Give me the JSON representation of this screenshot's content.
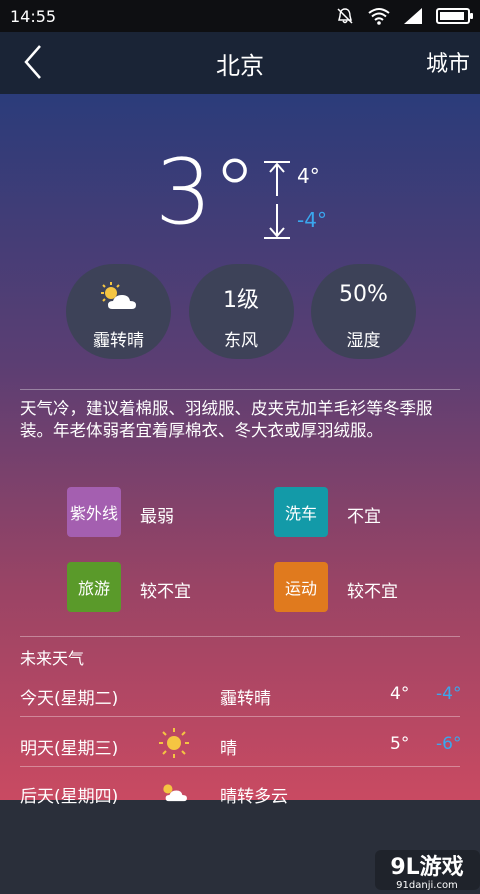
{
  "status_bar": {
    "time": "14:55"
  },
  "header": {
    "title": "北京",
    "city_button": "城市"
  },
  "current": {
    "temperature": "3°",
    "high": "4°",
    "low": "-4°"
  },
  "circles": [
    {
      "icon": "partly-cloudy-icon",
      "label": "霾转晴"
    },
    {
      "value": "1级",
      "label": "东风"
    },
    {
      "value": "50%",
      "label": "湿度"
    }
  ],
  "advice": "天气冷，建议着棉服、羽绒服、皮夹克加羊毛衫等冬季服装。年老体弱者宜着厚棉衣、冬大衣或厚羽绒服。",
  "indices": [
    {
      "name": "紫外线",
      "value": "最弱",
      "color": "#a45fb0"
    },
    {
      "name": "洗车",
      "value": "不宜",
      "color": "#139aa8"
    },
    {
      "name": "旅游",
      "value": "较不宜",
      "color": "#5a9a2a"
    },
    {
      "name": "运动",
      "value": "较不宜",
      "color": "#e07a1e"
    }
  ],
  "forecast": {
    "title": "未来天气",
    "days": [
      {
        "day": "今天(星期二)",
        "desc": "霾转晴",
        "high": "4°",
        "low": "-4°"
      },
      {
        "day": "明天(星期三)",
        "icon": "sun-icon",
        "desc": "晴",
        "high": "5°",
        "low": "-6°"
      },
      {
        "day": "后天(星期四)",
        "icon": "partly-cloudy-icon",
        "desc": "晴转多云",
        "high": "",
        "low": ""
      }
    ]
  },
  "watermark": {
    "logo": "9L游戏",
    "url": "91danji.com"
  }
}
